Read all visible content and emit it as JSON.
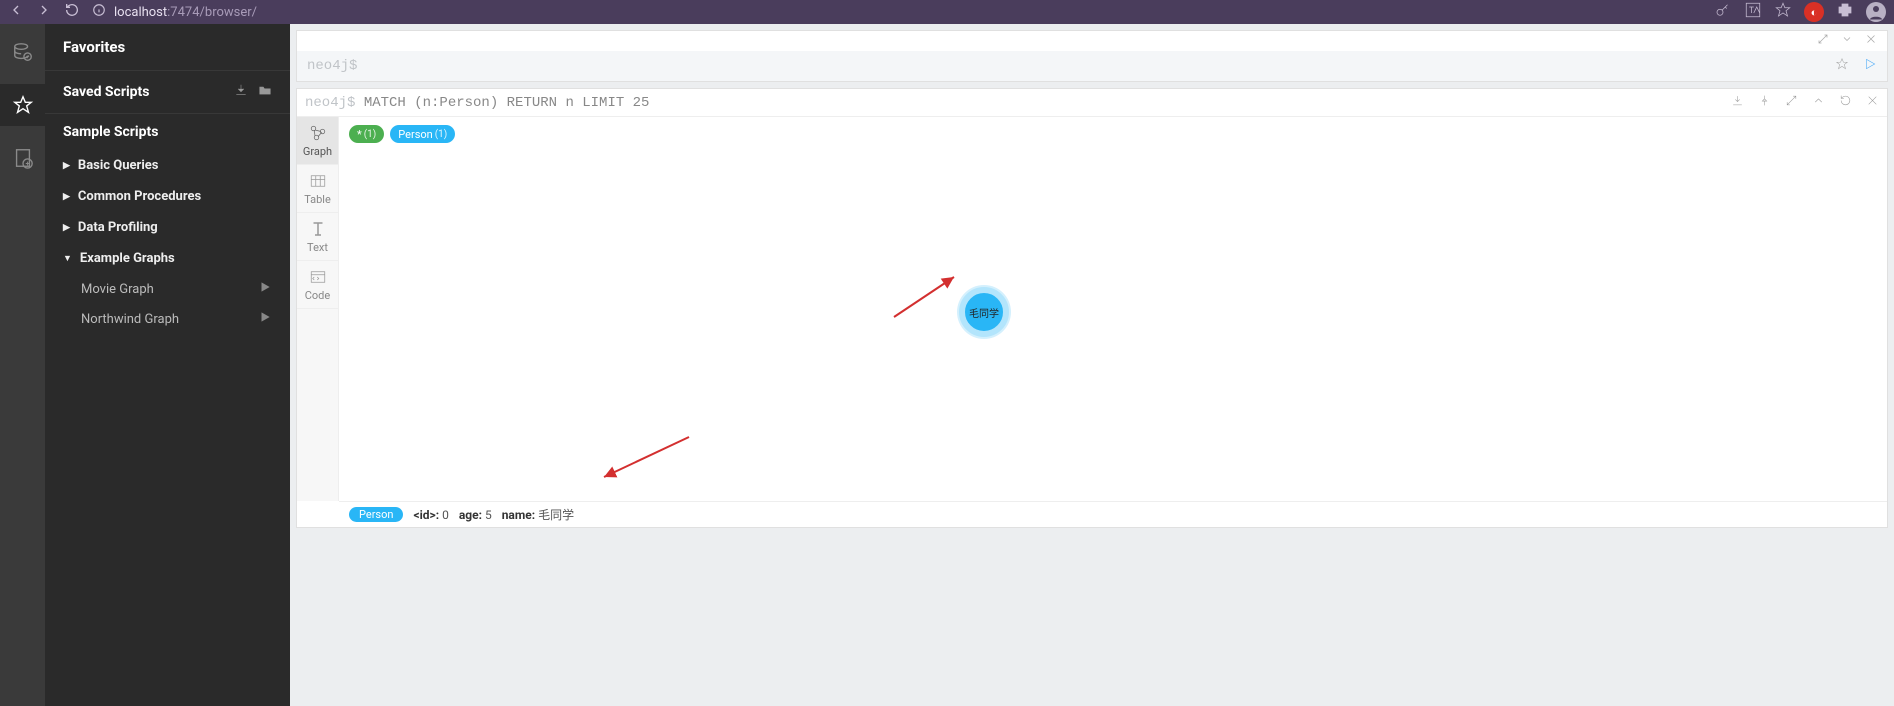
{
  "browser": {
    "url_prefix": "localhost",
    "url_suffix": ":7474/browser/"
  },
  "sidebar": {
    "title": "Favorites",
    "saved_scripts_label": "Saved Scripts",
    "sample_scripts_label": "Sample Scripts",
    "groups": {
      "basic": "Basic Queries",
      "common": "Common Procedures",
      "profiling": "Data Profiling",
      "examples": "Example Graphs"
    },
    "examples": {
      "movie": "Movie Graph",
      "northwind": "Northwind Graph"
    }
  },
  "editor": {
    "prompt": "neo4j$"
  },
  "result": {
    "prompt": "neo4j$ ",
    "query": "MATCH (n:Person) RETURN n LIMIT 25",
    "viz_tabs": {
      "graph": "Graph",
      "table": "Table",
      "text": "Text",
      "code": "Code"
    },
    "chips": {
      "all_label": "*",
      "all_count": "(1)",
      "person_label": "Person",
      "person_count": "(1)"
    },
    "node_label": "毛同学",
    "footer": {
      "label": "Person",
      "id_key": "<id>:",
      "id_val": "0",
      "age_key": "age:",
      "age_val": "5",
      "name_key": "name:",
      "name_val": "毛同学"
    }
  }
}
